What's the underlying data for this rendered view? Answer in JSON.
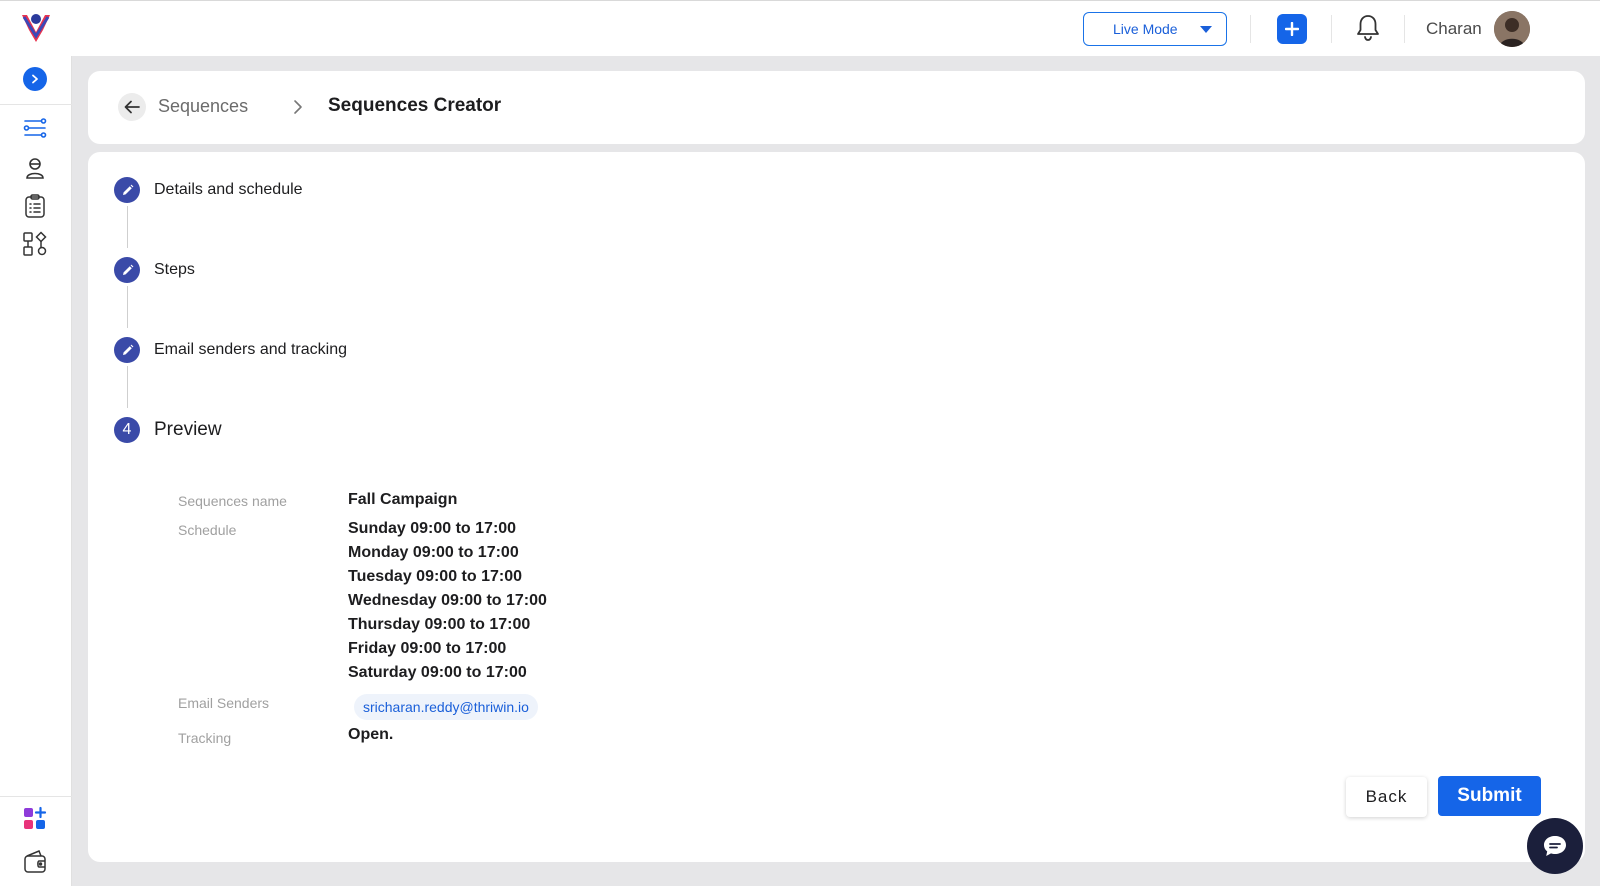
{
  "topbar": {
    "mode_label": "Live Mode",
    "user_name": "Charan"
  },
  "breadcrumb": {
    "parent": "Sequences",
    "current": "Sequences Creator"
  },
  "steps": [
    {
      "label": "Details and schedule",
      "state": "completed"
    },
    {
      "label": "Steps",
      "state": "completed"
    },
    {
      "label": "Email senders and tracking",
      "state": "completed"
    },
    {
      "label": "Preview",
      "number": "4",
      "state": "active"
    }
  ],
  "preview": {
    "name_label": "Sequences name",
    "name_value": "Fall Campaign",
    "schedule_label": "Schedule",
    "schedule": [
      "Sunday 09:00 to 17:00",
      "Monday 09:00 to 17:00",
      "Tuesday 09:00 to 17:00",
      "Wednesday 09:00 to 17:00",
      "Thursday 09:00 to 17:00",
      "Friday 09:00 to 17:00",
      "Saturday 09:00 to 17:00"
    ],
    "senders_label": "Email Senders",
    "senders": [
      "sricharan.reddy@thriwin.io"
    ],
    "tracking_label": "Tracking",
    "tracking_value": "Open."
  },
  "actions": {
    "back": "Back",
    "submit": "Submit"
  },
  "colors": {
    "primary": "#1565e8",
    "step": "#3a4aa8",
    "page_bg": "#e6e6e8"
  }
}
